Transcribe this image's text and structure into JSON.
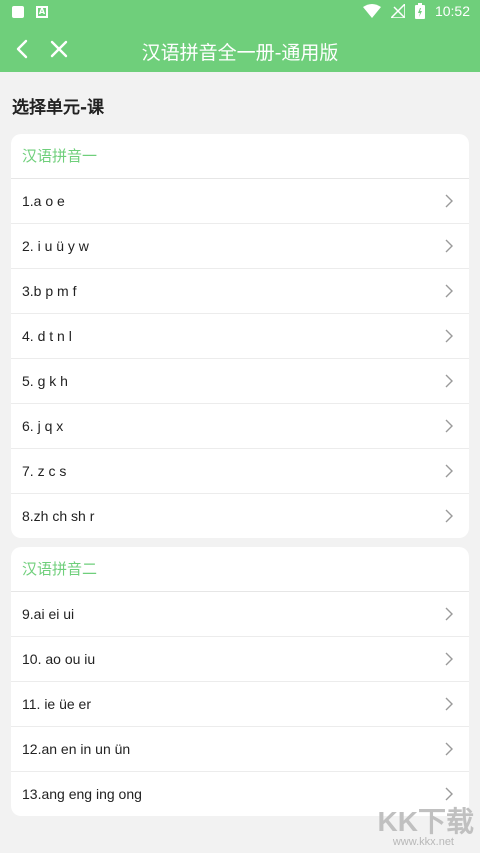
{
  "status": {
    "time": "10:52"
  },
  "header": {
    "title": "汉语拼音全一册-通用版"
  },
  "section_title": "选择单元-课",
  "units": [
    {
      "name": "汉语拼音一",
      "lessons": [
        "1.a o e",
        "2. i u ü y w",
        "3.b p m f",
        "4. d t n l",
        "5. g k h",
        "6. j q x",
        "7. z c s",
        "8.zh ch sh r"
      ]
    },
    {
      "name": "汉语拼音二",
      "lessons": [
        "9.ai ei ui",
        "10. ao ou iu",
        "11. ie üe er",
        "12.an en in un ün",
        "13.ang eng ing ong"
      ]
    }
  ],
  "watermark": {
    "brand": "KK下载",
    "url": "www.kkx.net"
  },
  "colors": {
    "accent": "#6fcf7b",
    "background": "#f2f2f2"
  }
}
